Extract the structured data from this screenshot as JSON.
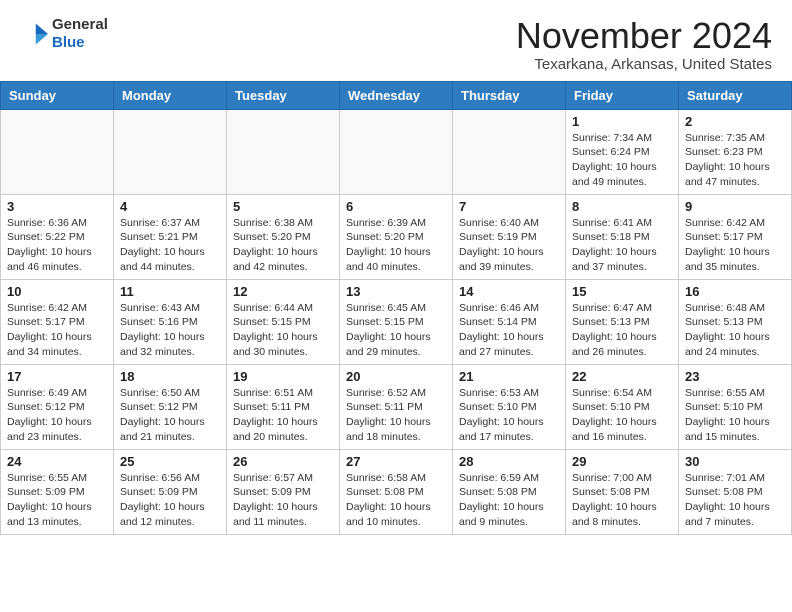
{
  "header": {
    "logo_line1": "General",
    "logo_line2": "Blue",
    "month_title": "November 2024",
    "location": "Texarkana, Arkansas, United States"
  },
  "weekdays": [
    "Sunday",
    "Monday",
    "Tuesday",
    "Wednesday",
    "Thursday",
    "Friday",
    "Saturday"
  ],
  "weeks": [
    [
      {
        "day": "",
        "detail": ""
      },
      {
        "day": "",
        "detail": ""
      },
      {
        "day": "",
        "detail": ""
      },
      {
        "day": "",
        "detail": ""
      },
      {
        "day": "",
        "detail": ""
      },
      {
        "day": "1",
        "detail": "Sunrise: 7:34 AM\nSunset: 6:24 PM\nDaylight: 10 hours\nand 49 minutes."
      },
      {
        "day": "2",
        "detail": "Sunrise: 7:35 AM\nSunset: 6:23 PM\nDaylight: 10 hours\nand 47 minutes."
      }
    ],
    [
      {
        "day": "3",
        "detail": "Sunrise: 6:36 AM\nSunset: 5:22 PM\nDaylight: 10 hours\nand 46 minutes."
      },
      {
        "day": "4",
        "detail": "Sunrise: 6:37 AM\nSunset: 5:21 PM\nDaylight: 10 hours\nand 44 minutes."
      },
      {
        "day": "5",
        "detail": "Sunrise: 6:38 AM\nSunset: 5:20 PM\nDaylight: 10 hours\nand 42 minutes."
      },
      {
        "day": "6",
        "detail": "Sunrise: 6:39 AM\nSunset: 5:20 PM\nDaylight: 10 hours\nand 40 minutes."
      },
      {
        "day": "7",
        "detail": "Sunrise: 6:40 AM\nSunset: 5:19 PM\nDaylight: 10 hours\nand 39 minutes."
      },
      {
        "day": "8",
        "detail": "Sunrise: 6:41 AM\nSunset: 5:18 PM\nDaylight: 10 hours\nand 37 minutes."
      },
      {
        "day": "9",
        "detail": "Sunrise: 6:42 AM\nSunset: 5:17 PM\nDaylight: 10 hours\nand 35 minutes."
      }
    ],
    [
      {
        "day": "10",
        "detail": "Sunrise: 6:42 AM\nSunset: 5:17 PM\nDaylight: 10 hours\nand 34 minutes."
      },
      {
        "day": "11",
        "detail": "Sunrise: 6:43 AM\nSunset: 5:16 PM\nDaylight: 10 hours\nand 32 minutes."
      },
      {
        "day": "12",
        "detail": "Sunrise: 6:44 AM\nSunset: 5:15 PM\nDaylight: 10 hours\nand 30 minutes."
      },
      {
        "day": "13",
        "detail": "Sunrise: 6:45 AM\nSunset: 5:15 PM\nDaylight: 10 hours\nand 29 minutes."
      },
      {
        "day": "14",
        "detail": "Sunrise: 6:46 AM\nSunset: 5:14 PM\nDaylight: 10 hours\nand 27 minutes."
      },
      {
        "day": "15",
        "detail": "Sunrise: 6:47 AM\nSunset: 5:13 PM\nDaylight: 10 hours\nand 26 minutes."
      },
      {
        "day": "16",
        "detail": "Sunrise: 6:48 AM\nSunset: 5:13 PM\nDaylight: 10 hours\nand 24 minutes."
      }
    ],
    [
      {
        "day": "17",
        "detail": "Sunrise: 6:49 AM\nSunset: 5:12 PM\nDaylight: 10 hours\nand 23 minutes."
      },
      {
        "day": "18",
        "detail": "Sunrise: 6:50 AM\nSunset: 5:12 PM\nDaylight: 10 hours\nand 21 minutes."
      },
      {
        "day": "19",
        "detail": "Sunrise: 6:51 AM\nSunset: 5:11 PM\nDaylight: 10 hours\nand 20 minutes."
      },
      {
        "day": "20",
        "detail": "Sunrise: 6:52 AM\nSunset: 5:11 PM\nDaylight: 10 hours\nand 18 minutes."
      },
      {
        "day": "21",
        "detail": "Sunrise: 6:53 AM\nSunset: 5:10 PM\nDaylight: 10 hours\nand 17 minutes."
      },
      {
        "day": "22",
        "detail": "Sunrise: 6:54 AM\nSunset: 5:10 PM\nDaylight: 10 hours\nand 16 minutes."
      },
      {
        "day": "23",
        "detail": "Sunrise: 6:55 AM\nSunset: 5:10 PM\nDaylight: 10 hours\nand 15 minutes."
      }
    ],
    [
      {
        "day": "24",
        "detail": "Sunrise: 6:55 AM\nSunset: 5:09 PM\nDaylight: 10 hours\nand 13 minutes."
      },
      {
        "day": "25",
        "detail": "Sunrise: 6:56 AM\nSunset: 5:09 PM\nDaylight: 10 hours\nand 12 minutes."
      },
      {
        "day": "26",
        "detail": "Sunrise: 6:57 AM\nSunset: 5:09 PM\nDaylight: 10 hours\nand 11 minutes."
      },
      {
        "day": "27",
        "detail": "Sunrise: 6:58 AM\nSunset: 5:08 PM\nDaylight: 10 hours\nand 10 minutes."
      },
      {
        "day": "28",
        "detail": "Sunrise: 6:59 AM\nSunset: 5:08 PM\nDaylight: 10 hours\nand 9 minutes."
      },
      {
        "day": "29",
        "detail": "Sunrise: 7:00 AM\nSunset: 5:08 PM\nDaylight: 10 hours\nand 8 minutes."
      },
      {
        "day": "30",
        "detail": "Sunrise: 7:01 AM\nSunset: 5:08 PM\nDaylight: 10 hours\nand 7 minutes."
      }
    ]
  ]
}
